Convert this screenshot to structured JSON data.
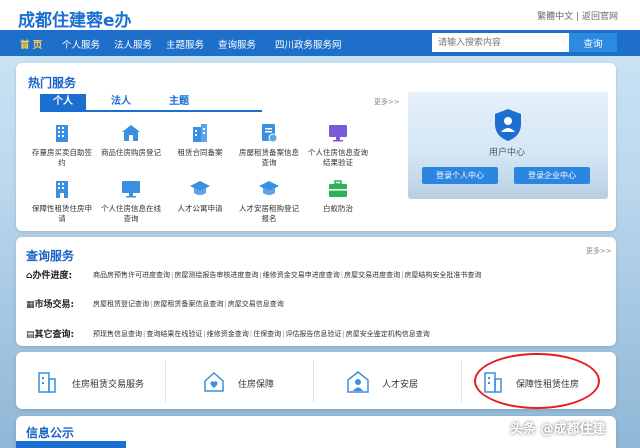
{
  "header": {
    "logo": "成都住建蓉e办",
    "lang_link": "繁體中文",
    "separator": "|",
    "old_site_link": "返回官网"
  },
  "nav": {
    "items": [
      "首 页",
      "个人服务",
      "法人服务",
      "主题服务",
      "查询服务",
      "四川政务服务网"
    ]
  },
  "search": {
    "placeholder": "请输入搜索内容",
    "button": "查询"
  },
  "hot_services": {
    "title": "热门服务",
    "more": "更多>>",
    "tabs": [
      "个人",
      "法人",
      "主题"
    ],
    "items": [
      {
        "label": "存量房买卖自助签约",
        "icon": "building-icon"
      },
      {
        "label": "商品住房购房登记",
        "icon": "house-icon"
      },
      {
        "label": "租赁合同备案",
        "icon": "building-icon"
      },
      {
        "label": "房屋租赁备案信息查询",
        "icon": "document-icon"
      },
      {
        "label": "个人住房信息查询结果验证",
        "icon": "monitor-icon"
      },
      {
        "label": "保障性租赁住房申请",
        "icon": "building-icon"
      },
      {
        "label": "个人住房信息在线查询",
        "icon": "monitor-icon"
      },
      {
        "label": "人才公寓申请",
        "icon": "graduation-cap-icon"
      },
      {
        "label": "人才安居租购登记报名",
        "icon": "graduation-cap-icon"
      },
      {
        "label": "白蚁防治",
        "icon": "briefcase-icon"
      }
    ]
  },
  "user_center": {
    "title": "用户中心",
    "login_personal": "登录个人中心",
    "login_enterprise": "登录企业中心"
  },
  "query_services": {
    "title": "查询服务",
    "more": "更多>>",
    "rows": [
      {
        "label": "办件进度:",
        "links": [
          "商品房预售许可进度查询",
          "房屋测绘报告审核进度查询",
          "维修资金交易申进度查询",
          "房屋交易进度查询",
          "房屋结构安全批准书查询"
        ]
      },
      {
        "label": "市场交易:",
        "links": [
          "房屋租赁登记查询",
          "房屋租赁备案信息查询",
          "房屋交易信息查询"
        ]
      },
      {
        "label": "其它查询:",
        "links": [
          "预现售信息查询",
          "查询结果在线验证",
          "维修资金查询",
          "住保查询",
          "评估报告信息验证",
          "房屋安全鉴定机构信息查询"
        ]
      }
    ]
  },
  "bottom_services": [
    "住房租赁交易服务",
    "住房保障",
    "人才安居",
    "保障性租赁住房"
  ],
  "info": {
    "title": "信息公示"
  },
  "watermark": "头条 @成都住建",
  "colors": {
    "primary": "#1a6fd1",
    "nav_bg": "#1e6fc9",
    "highlight_circle": "#e41e1e",
    "nav_active": "#ffd34d"
  }
}
